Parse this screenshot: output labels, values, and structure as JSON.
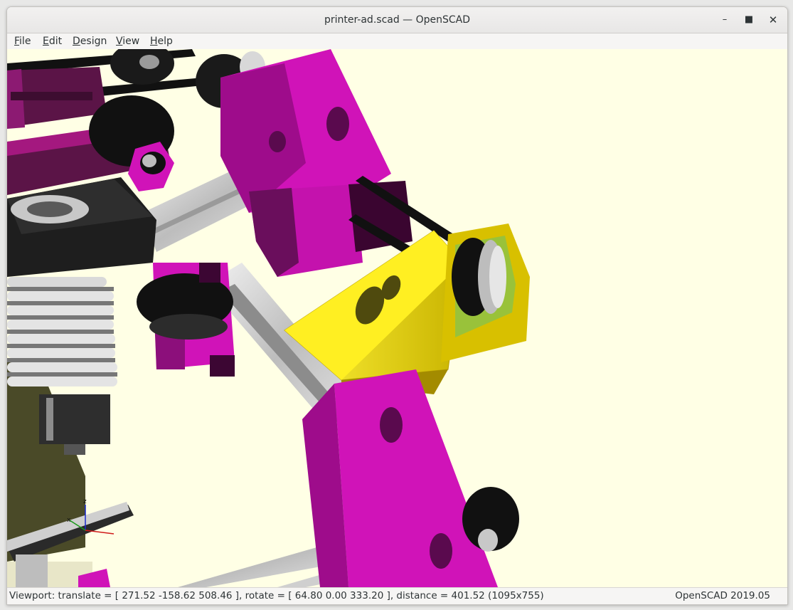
{
  "window": {
    "title": "printer-ad.scad — OpenSCAD",
    "minimize_glyph": "–",
    "maximize_glyph": "■",
    "close_glyph": "✕"
  },
  "menu": {
    "items": [
      {
        "pre": "",
        "u": "F",
        "post": "ile"
      },
      {
        "pre": "",
        "u": "E",
        "post": "dit"
      },
      {
        "pre": "",
        "u": "D",
        "post": "esign"
      },
      {
        "pre": "",
        "u": "V",
        "post": "iew"
      },
      {
        "pre": "",
        "u": "H",
        "post": "elp"
      }
    ]
  },
  "viewport": {
    "background_color": "#ffffe5",
    "highlight_color": "#f5e000",
    "part_color": "#e020c8",
    "axes": {
      "x": "x",
      "z": "z"
    }
  },
  "status": {
    "viewport_info": "Viewport: translate = [ 271.52 -158.62 508.46 ], rotate = [ 64.80 0.00 333.20 ], distance = 401.52 (1095x755)",
    "version": "OpenSCAD 2019.05"
  }
}
